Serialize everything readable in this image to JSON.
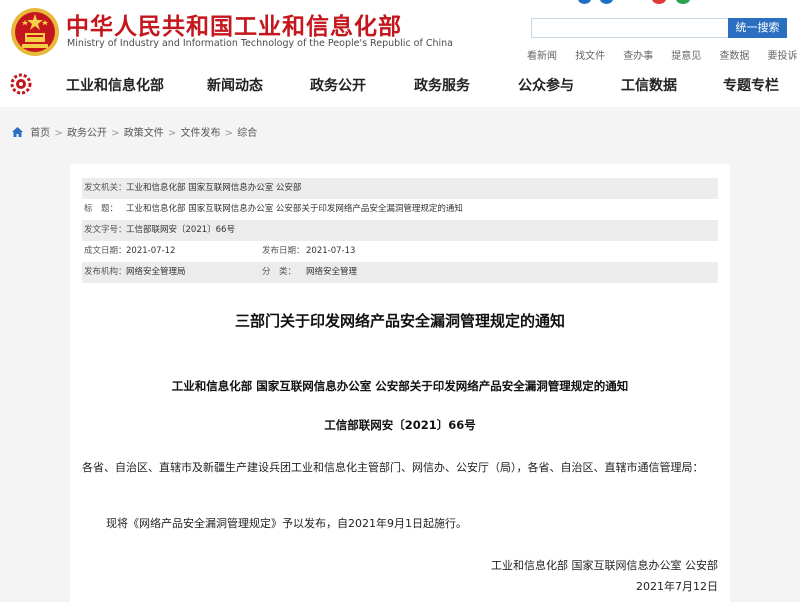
{
  "header": {
    "site_title_cn": "中华人民共和国工业和信息化部",
    "site_title_en": "Ministry of Industry and Information Technology of the People's Republic of China",
    "search_placeholder": "",
    "search_button": "统一搜索",
    "quick_links": [
      "看新闻",
      "找文件",
      "查办事",
      "提意见",
      "查数据",
      "要投诉"
    ],
    "brand_color": "#c4161c",
    "accent_color": "#2c6fc1"
  },
  "nav": {
    "items": [
      "工业和信息化部",
      "新闻动态",
      "政务公开",
      "政务服务",
      "公众参与",
      "工信数据",
      "专题专栏"
    ]
  },
  "breadcrumb": {
    "items": [
      "首页",
      "政务公开",
      "政策文件",
      "文件发布",
      "综合"
    ],
    "separator": ">"
  },
  "meta": {
    "issuer_label": "发文机关：",
    "issuer": "工业和信息化部 国家互联网信息办公室 公安部",
    "title_label": "标　题：",
    "title": "工业和信息化部 国家互联网信息办公室 公安部关于印发网络产品安全漏洞管理规定的通知",
    "doc_no_label": "发文字号：",
    "doc_no": "工信部联网安〔2021〕66号",
    "created_label": "成文日期：",
    "created": "2021-07-12",
    "published_label": "发布日期：",
    "published": "2021-07-13",
    "agency_label": "发布机构：",
    "agency": "网络安全管理局",
    "category_label": "分　类：",
    "category": "网络安全管理"
  },
  "document": {
    "title": "三部门关于印发网络产品安全漏洞管理规定的通知",
    "subtitle": "工业和信息化部 国家互联网信息办公室 公安部关于印发网络产品安全漏洞管理规定的通知",
    "number": "工信部联网安〔2021〕66号",
    "addressee": "各省、自治区、直辖市及新疆生产建设兵团工业和信息化主管部门、网信办、公安厅（局），各省、自治区、直辖市通信管理局：",
    "body": "现将《网络产品安全漏洞管理规定》予以发布，自2021年9月1日起施行。",
    "sign_org": "工业和信息化部 国家互联网信息办公室 公安部",
    "sign_date": "2021年7月12日"
  }
}
